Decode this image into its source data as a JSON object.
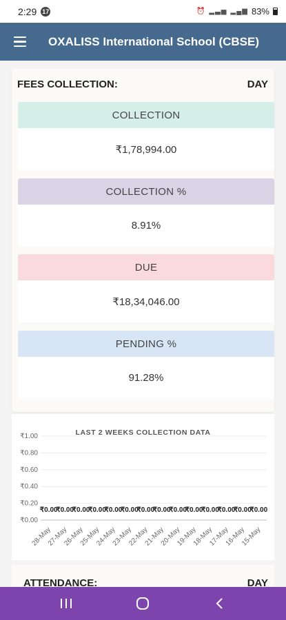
{
  "status_bar": {
    "time": "2:29",
    "notification_count": "17",
    "battery": "83%"
  },
  "app_bar": {
    "title": "OXALISS International School (CBSE)"
  },
  "fees": {
    "heading": "FEES COLLECTION:",
    "period": "DAY",
    "metrics": [
      {
        "label": "COLLECTION",
        "value": "₹1,78,994.00",
        "color": "#d5eee7"
      },
      {
        "label": "COLLECTION %",
        "value": "8.91%",
        "color": "#d8d4e6"
      },
      {
        "label": "DUE",
        "value": "₹18,34,046.00",
        "color": "#fadadd"
      },
      {
        "label": "PENDING %",
        "value": "91.28%",
        "color": "#d8e5f5"
      }
    ]
  },
  "chart_data": {
    "type": "bar",
    "title": "LAST 2 WEEKS COLLECTION DATA",
    "categories": [
      "28-May",
      "27-May",
      "26-May",
      "25-May",
      "24-May",
      "23-May",
      "22-May",
      "21-May",
      "20-May",
      "19-May",
      "18-May",
      "17-May",
      "16-May",
      "15-May"
    ],
    "values": [
      0,
      0,
      0,
      0,
      0,
      0,
      0,
      0,
      0,
      0,
      0,
      0,
      0,
      0
    ],
    "data_labels": [
      "₹0.00",
      "₹0.00",
      "₹0.00",
      "₹0.00",
      "₹0.00",
      "₹0.00",
      "₹0.00",
      "₹0.00",
      "₹0.00",
      "₹0.00",
      "₹0.00",
      "₹0.00",
      "₹0.00",
      "₹0.00"
    ],
    "ylim": [
      0,
      1
    ],
    "y_ticks": [
      "₹0.00",
      "₹0.20",
      "₹0.40",
      "₹0.60",
      "₹0.80",
      "₹1.00"
    ],
    "grid": true,
    "xlabel": "",
    "ylabel": ""
  },
  "attendance": {
    "heading": "ATTENDANCE:",
    "period": "DAY"
  },
  "nav": {
    "recents": "recents-button",
    "home": "home-button",
    "back": "back-button"
  }
}
